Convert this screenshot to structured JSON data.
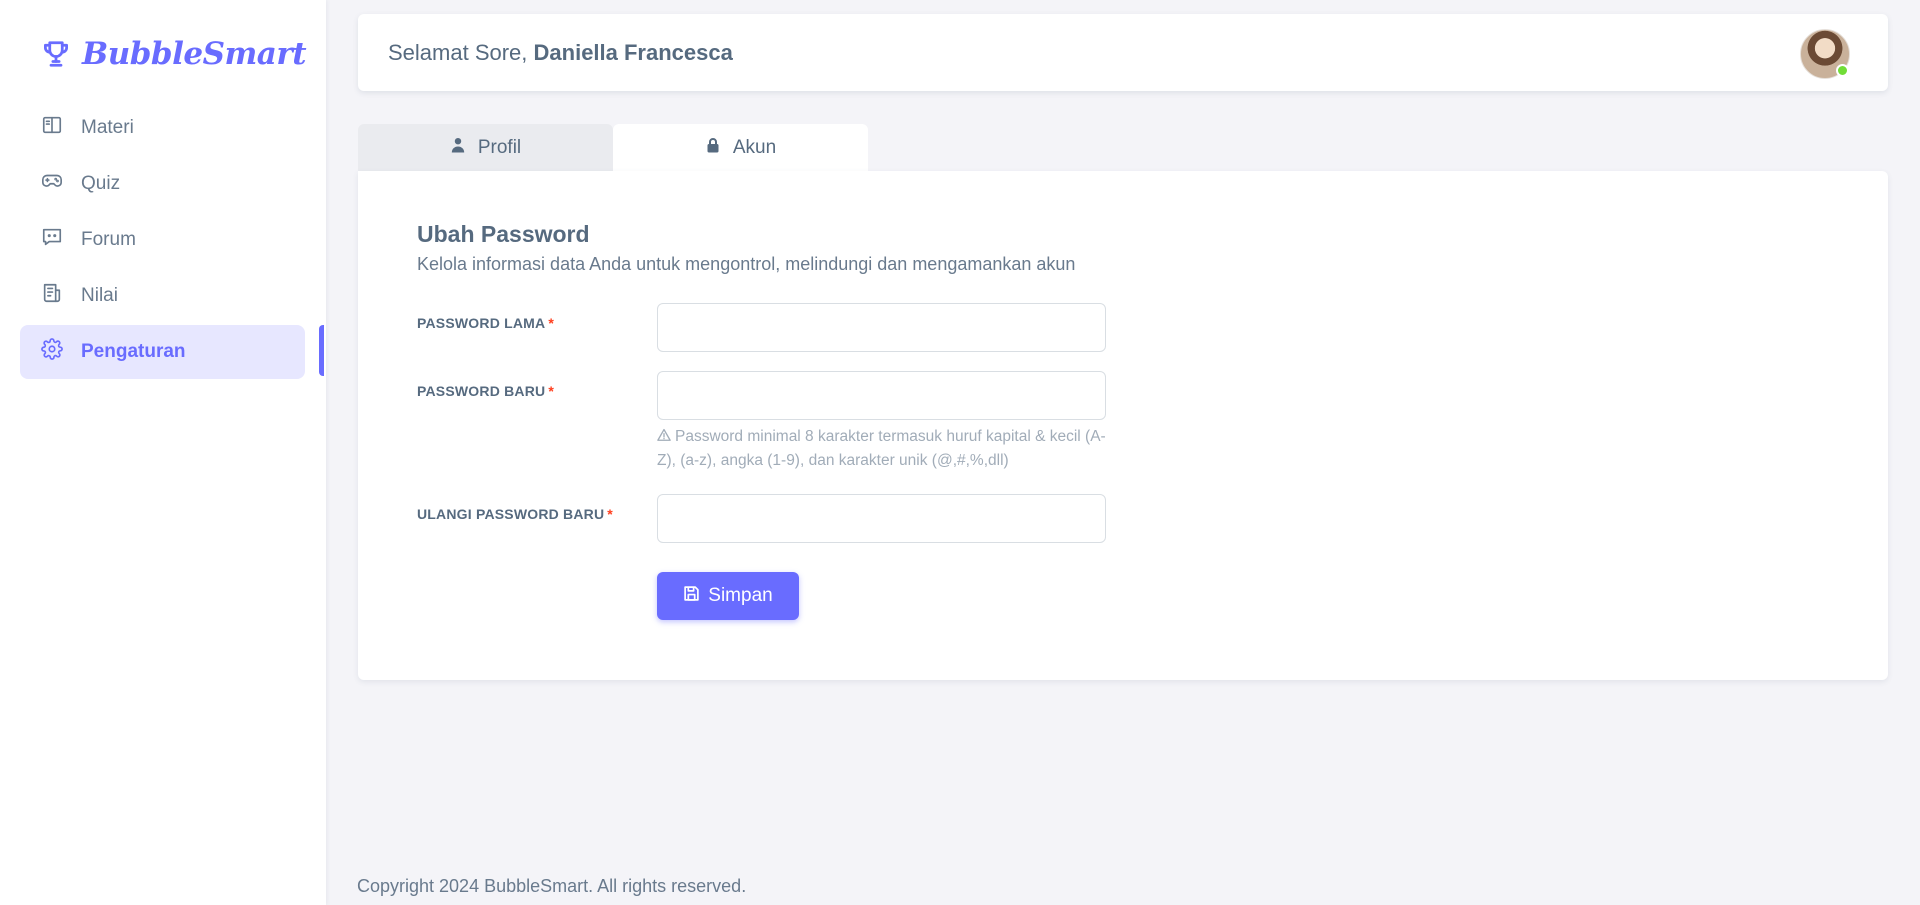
{
  "brand": {
    "name": "BubbleSmart",
    "icon": "trophy-icon",
    "color": "#696cff"
  },
  "sidebar": {
    "items": [
      {
        "label": "Materi",
        "icon": "book-icon",
        "active": false
      },
      {
        "label": "Quiz",
        "icon": "gamepad-icon",
        "active": false
      },
      {
        "label": "Forum",
        "icon": "chat-icon",
        "active": false
      },
      {
        "label": "Nilai",
        "icon": "report-icon",
        "active": false
      },
      {
        "label": "Pengaturan",
        "icon": "gear-icon",
        "active": true
      }
    ]
  },
  "header": {
    "greeting": "Selamat Sore, ",
    "user_name": "Daniella Francesca",
    "avatar_status": "online"
  },
  "tabs": [
    {
      "label": "Profil",
      "icon": "user-icon",
      "active": false
    },
    {
      "label": "Akun",
      "icon": "lock-icon",
      "active": true
    }
  ],
  "form": {
    "title": "Ubah Password",
    "subtitle": "Kelola informasi data Anda untuk mengontrol, melindungi dan mengamankan akun",
    "fields": [
      {
        "label": "PASSWORD LAMA",
        "required_mark": "*",
        "value": ""
      },
      {
        "label": "PASSWORD BARU",
        "required_mark": "*",
        "value": ""
      },
      {
        "label": "ULANGI PASSWORD BARU",
        "required_mark": "*",
        "value": ""
      }
    ],
    "hint": "Password minimal 8 karakter termasuk huruf kapital & kecil (A-Z), (a-z), angka (1-9), dan karakter unik (@,#,%,dll)",
    "save_label": "Simpan"
  },
  "footer": {
    "text": "Copyright 2024 BubbleSmart. All rights reserved."
  },
  "colors": {
    "accent": "#696cff",
    "accent_light": "#e7e7ff",
    "required": "#ff3e1d",
    "online": "#71dd37"
  }
}
